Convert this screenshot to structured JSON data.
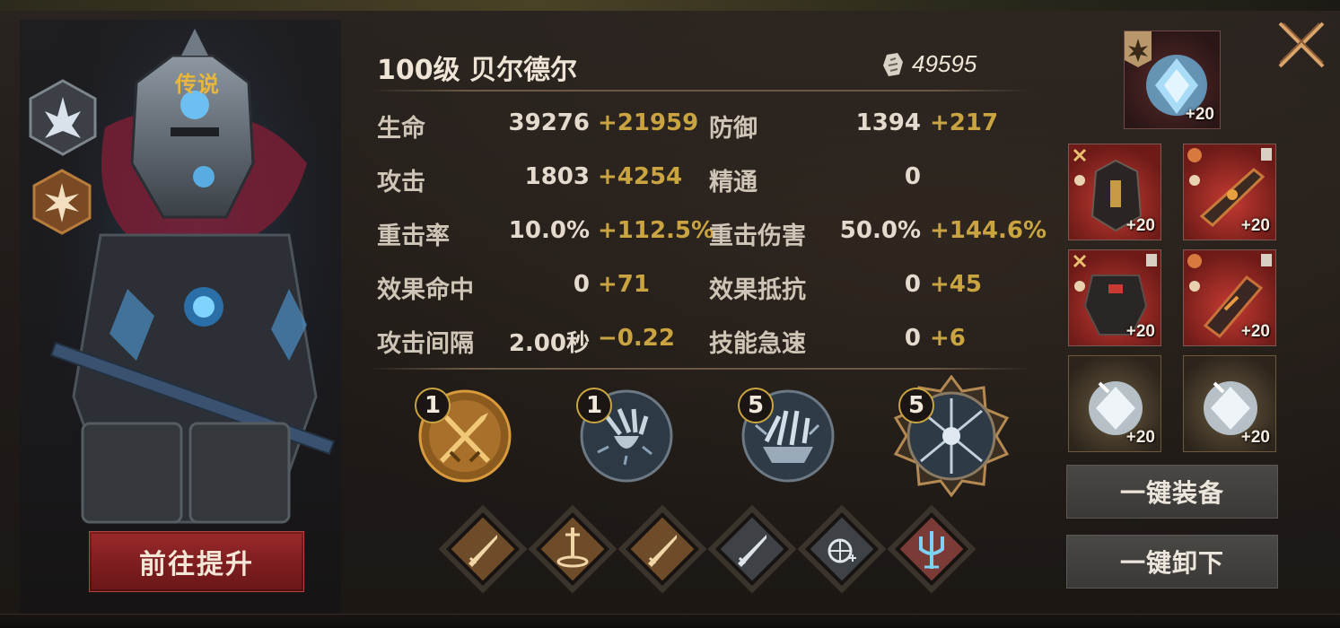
{
  "hero": {
    "rarity": "传说",
    "upgrade_button": "前往提升"
  },
  "header": {
    "title": "100级  贝尔德尔",
    "power_value": "49595",
    "power_icon": "shard-currency-icon"
  },
  "stats": [
    {
      "label": "生命",
      "base": "39276",
      "bonus": "+21959"
    },
    {
      "label": "防御",
      "base": "1394",
      "bonus": "+217"
    },
    {
      "label": "攻击",
      "base": "1803",
      "bonus": "+4254"
    },
    {
      "label": "精通",
      "base": "0",
      "bonus": ""
    },
    {
      "label": "重击率",
      "base": "10.0%",
      "bonus": "+112.5%"
    },
    {
      "label": "重击伤害",
      "base": "50.0%",
      "bonus": "+144.6%"
    },
    {
      "label": "效果命中",
      "base": "0",
      "bonus": "+71"
    },
    {
      "label": "效果抵抗",
      "base": "0",
      "bonus": "+45"
    },
    {
      "label": "攻击间隔",
      "base": "2.00秒",
      "bonus": "−0.22"
    },
    {
      "label": "技能急速",
      "base": "0",
      "bonus": "+6"
    }
  ],
  "skills": [
    {
      "level": "1",
      "icon": "crossed-swords-icon"
    },
    {
      "level": "1",
      "icon": "claw-strike-icon"
    },
    {
      "level": "5",
      "icon": "ice-claw-icon"
    },
    {
      "level": "5",
      "icon": "shatter-burst-icon"
    }
  ],
  "runes": [
    {
      "icon": "sword-rune-icon"
    },
    {
      "icon": "sword-in-stone-rune-icon"
    },
    {
      "icon": "sword-rune-icon"
    },
    {
      "icon": "silver-sword-rune-icon"
    },
    {
      "icon": "crosshair-rune-icon"
    },
    {
      "icon": "trident-rune-icon"
    }
  ],
  "equipment": {
    "artifact_plus": "+20",
    "slots": [
      {
        "name": "helmet",
        "plus": "+20"
      },
      {
        "name": "gauntlet-weapon",
        "plus": "+20"
      },
      {
        "name": "chest-armor",
        "plus": "+20"
      },
      {
        "name": "gloves",
        "plus": "+20"
      },
      {
        "name": "ring-crystal",
        "plus": "+20"
      },
      {
        "name": "amulet-crystal",
        "plus": "+20"
      }
    ],
    "equip_all_button": "一键装备",
    "unequip_all_button": "一键卸下"
  },
  "colors": {
    "accent_gold": "#c9a441",
    "rarity_gold": "#e8b73c",
    "upgrade_red": "#8a2224"
  }
}
